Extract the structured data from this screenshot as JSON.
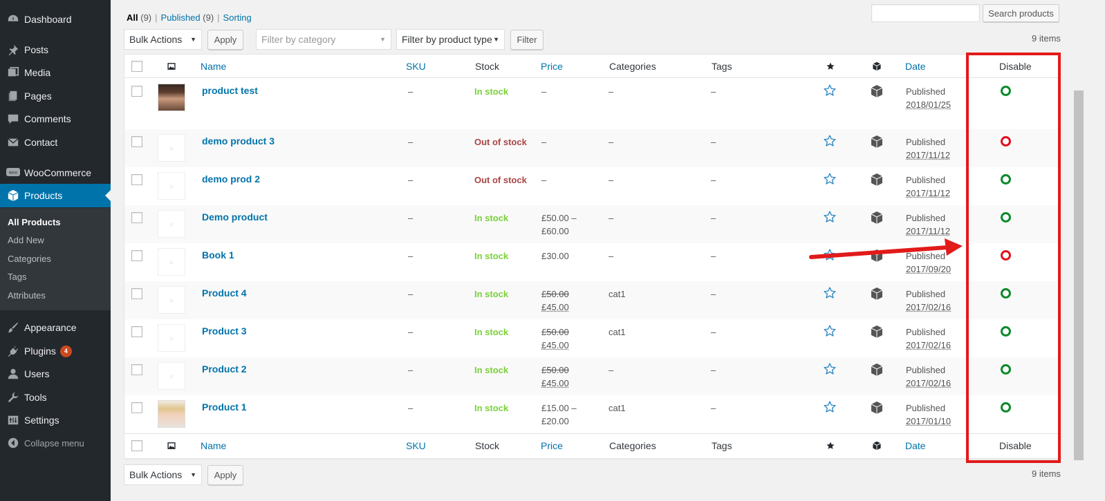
{
  "sidebar": {
    "items": [
      {
        "label": "Dashboard",
        "icon": "dashboard-icon"
      },
      {
        "label": "Posts",
        "icon": "pin-icon"
      },
      {
        "label": "Media",
        "icon": "media-icon"
      },
      {
        "label": "Pages",
        "icon": "pages-icon"
      },
      {
        "label": "Comments",
        "icon": "comment-icon"
      },
      {
        "label": "Contact",
        "icon": "mail-icon"
      },
      {
        "label": "WooCommerce",
        "icon": "woo-icon"
      },
      {
        "label": "Products",
        "icon": "cube-icon"
      },
      {
        "label": "Appearance",
        "icon": "brush-icon"
      },
      {
        "label": "Plugins",
        "icon": "plug-icon",
        "badge": "4"
      },
      {
        "label": "Users",
        "icon": "user-icon"
      },
      {
        "label": "Tools",
        "icon": "wrench-icon"
      },
      {
        "label": "Settings",
        "icon": "settings-icon"
      }
    ],
    "submenu": [
      "All Products",
      "Add New",
      "Categories",
      "Tags",
      "Attributes"
    ],
    "collapse_label": "Collapse menu"
  },
  "views": {
    "all_label": "All",
    "all_count": "(9)",
    "published_label": "Published",
    "published_count": "(9)",
    "sorting_label": "Sorting"
  },
  "search": {
    "value": "",
    "button_label": "Search products"
  },
  "toolbar": {
    "bulk_actions": "Bulk Actions",
    "apply_label": "Apply",
    "category_filter_placeholder": "Filter by category",
    "product_type_filter": "Filter by product type",
    "filter_button": "Filter",
    "items_count": "9 items"
  },
  "columns": {
    "name": "Name",
    "sku": "SKU",
    "stock": "Stock",
    "price": "Price",
    "categories": "Categories",
    "tags": "Tags",
    "date": "Date",
    "disable": "Disable"
  },
  "products": [
    {
      "name": "product test",
      "sku": "–",
      "stock": "In stock",
      "stock_status": "in",
      "price1": "–",
      "price2": "",
      "price_strike": false,
      "categories": "–",
      "tags": "–",
      "status": "Published",
      "date": "2018/01/25",
      "disable_state": "enabled",
      "thumb": "photo1"
    },
    {
      "name": "demo product 3",
      "sku": "–",
      "stock": "Out of stock",
      "stock_status": "out",
      "price1": "–",
      "price2": "",
      "price_strike": false,
      "categories": "–",
      "tags": "–",
      "status": "Published",
      "date": "2017/11/12",
      "disable_state": "disabled",
      "thumb": "placeholder"
    },
    {
      "name": "demo prod 2",
      "sku": "–",
      "stock": "Out of stock",
      "stock_status": "out",
      "price1": "–",
      "price2": "",
      "price_strike": false,
      "categories": "–",
      "tags": "–",
      "status": "Published",
      "date": "2017/11/12",
      "disable_state": "enabled",
      "thumb": "placeholder"
    },
    {
      "name": "Demo product",
      "sku": "–",
      "stock": "In stock",
      "stock_status": "in",
      "price1": "£50.00 –",
      "price2": "£60.00",
      "price_strike": false,
      "categories": "–",
      "tags": "–",
      "status": "Published",
      "date": "2017/11/12",
      "disable_state": "enabled",
      "thumb": "placeholder"
    },
    {
      "name": "Book 1",
      "sku": "–",
      "stock": "In stock",
      "stock_status": "in",
      "price1": "£30.00",
      "price2": "",
      "price_strike": false,
      "categories": "–",
      "tags": "–",
      "status": "Published",
      "date": "2017/09/20",
      "disable_state": "disabled",
      "thumb": "placeholder"
    },
    {
      "name": "Product 4",
      "sku": "–",
      "stock": "In stock",
      "stock_status": "in",
      "price1": "£50.00",
      "price2": "£45.00",
      "price_strike": true,
      "categories": "cat1",
      "tags": "–",
      "status": "Published",
      "date": "2017/02/16",
      "disable_state": "enabled",
      "thumb": "placeholder"
    },
    {
      "name": "Product 3",
      "sku": "–",
      "stock": "In stock",
      "stock_status": "in",
      "price1": "£50.00",
      "price2": "£45.00",
      "price_strike": true,
      "categories": "cat1",
      "tags": "–",
      "status": "Published",
      "date": "2017/02/16",
      "disable_state": "enabled",
      "thumb": "placeholder"
    },
    {
      "name": "Product 2",
      "sku": "–",
      "stock": "In stock",
      "stock_status": "in",
      "price1": "£50.00",
      "price2": "£45.00",
      "price_strike": true,
      "categories": "–",
      "tags": "–",
      "status": "Published",
      "date": "2017/02/16",
      "disable_state": "enabled",
      "thumb": "placeholder"
    },
    {
      "name": "Product 1",
      "sku": "–",
      "stock": "In stock",
      "stock_status": "in",
      "price1": "£15.00 –",
      "price2": "£20.00",
      "price_strike": false,
      "categories": "cat1",
      "tags": "–",
      "status": "Published",
      "date": "2017/01/10",
      "disable_state": "enabled",
      "thumb": "photo2"
    }
  ],
  "colors": {
    "in_stock": "#7ad03a",
    "out_of_stock": "#aa4444",
    "enabled": "#0a8a2a",
    "disabled": "#e2111d",
    "annotation": "#e21a1a",
    "link": "#0073aa"
  }
}
